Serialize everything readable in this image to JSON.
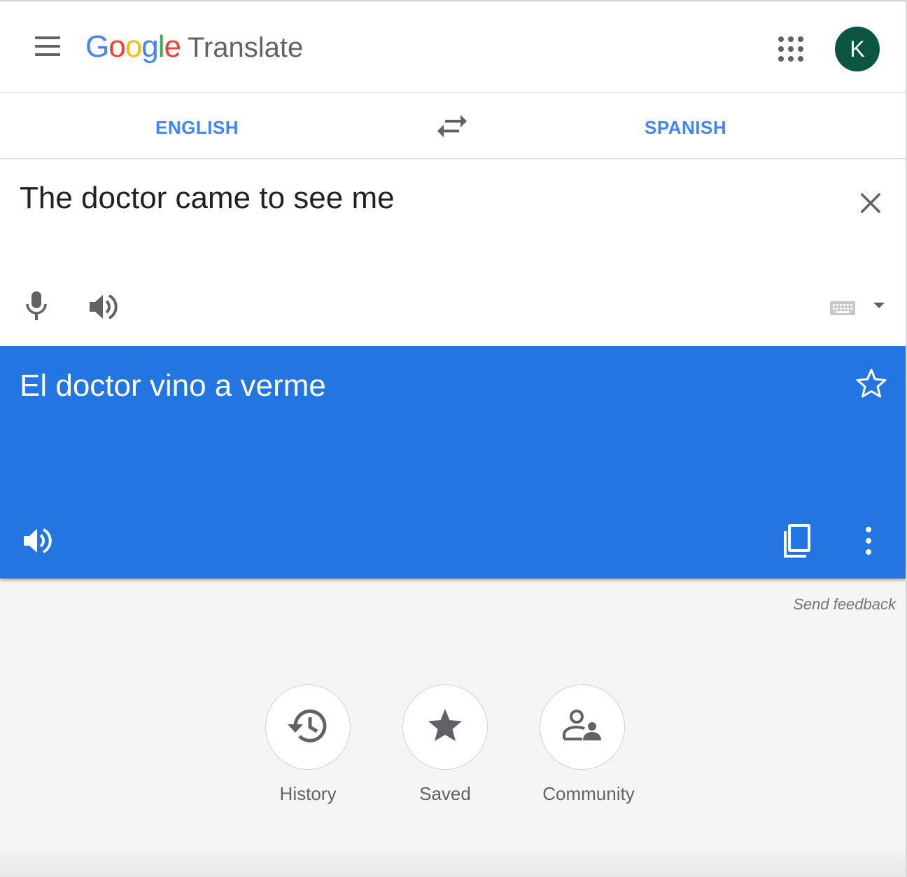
{
  "header": {
    "logo_letters": [
      {
        "ch": "G",
        "color": "#4285f4"
      },
      {
        "ch": "o",
        "color": "#ea4335"
      },
      {
        "ch": "o",
        "color": "#fbbc05"
      },
      {
        "ch": "g",
        "color": "#4285f4"
      },
      {
        "ch": "l",
        "color": "#34a853"
      },
      {
        "ch": "e",
        "color": "#ea4335"
      }
    ],
    "product_name": "Translate",
    "avatar_initial": "K",
    "icons": {
      "menu": "hamburger-menu-icon",
      "apps": "apps-grid-icon"
    }
  },
  "languages": {
    "source": "ENGLISH",
    "target": "SPANISH",
    "swap_icon": "swap-arrows-icon"
  },
  "source": {
    "text": "The doctor came to see me",
    "icons": [
      "close-icon",
      "microphone-icon",
      "speaker-icon",
      "keyboard-icon",
      "dropdown-arrow-icon"
    ]
  },
  "translation": {
    "text": "El doctor vino a verme",
    "icons": [
      "star-outline-icon",
      "speaker-icon",
      "copy-icon",
      "more-vert-icon"
    ]
  },
  "feedback_link": "Send feedback",
  "bottom_actions": [
    {
      "label": "History",
      "icon": "history-icon"
    },
    {
      "label": "Saved",
      "icon": "star-icon"
    },
    {
      "label": "Community",
      "icon": "community-icon"
    }
  ],
  "colors": {
    "accent_blue": "#4285f4",
    "translation_bg": "#2375e2",
    "avatar_bg": "#0c5543",
    "icon_gray": "#5f6368"
  }
}
